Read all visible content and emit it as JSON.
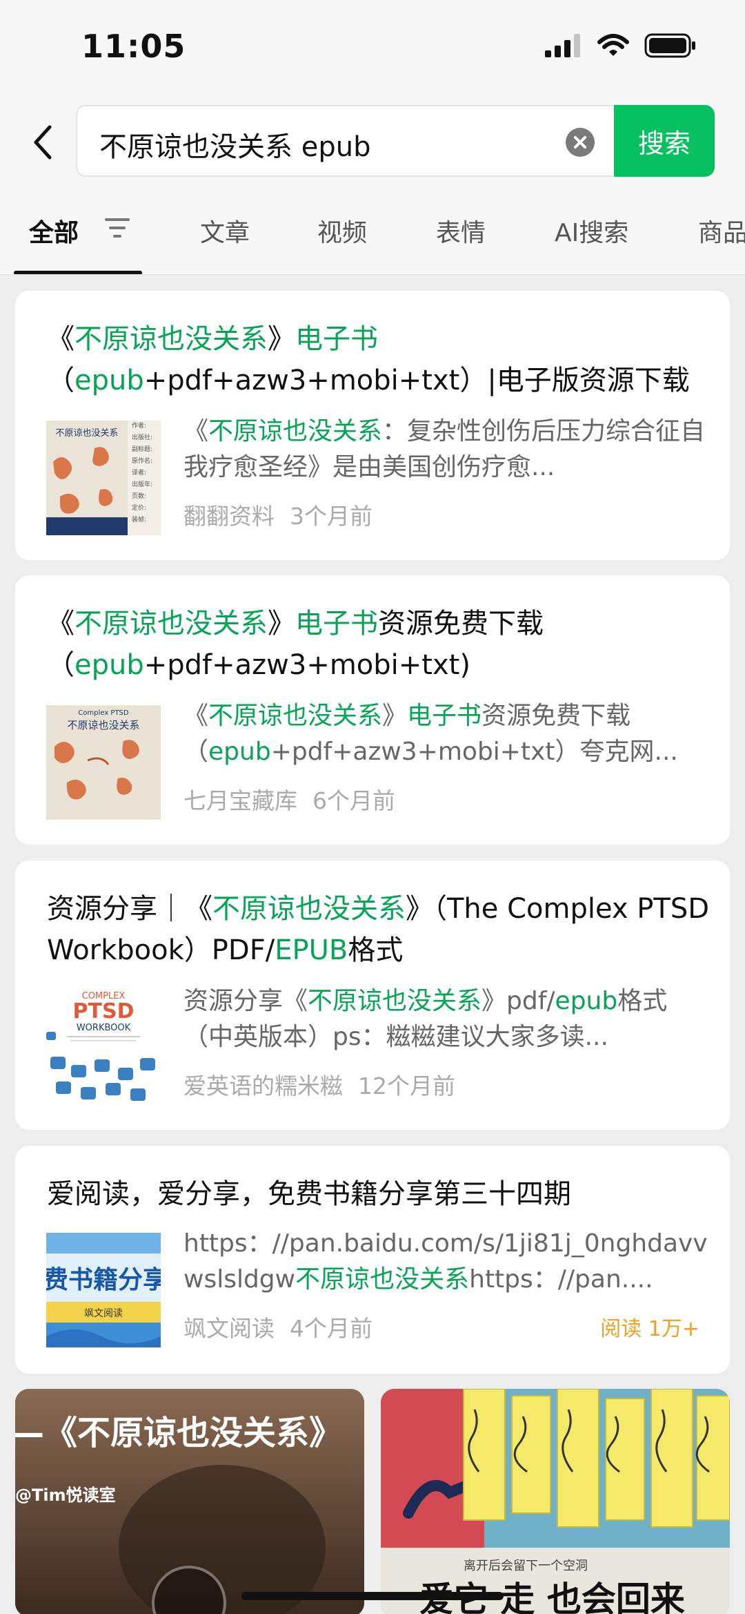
{
  "status_bar": {
    "time": "11:05"
  },
  "search": {
    "query": "不原谅也没关系 epub",
    "button_label": "搜索"
  },
  "tabs": [
    {
      "label": "全部",
      "active": true
    },
    {
      "label": "文章"
    },
    {
      "label": "视频"
    },
    {
      "label": "表情"
    },
    {
      "label": "AI搜索"
    },
    {
      "label": "商品"
    }
  ],
  "results": [
    {
      "title_parts": [
        "《",
        "不原谅也没关系",
        "》",
        "电子书",
        "（",
        "epub",
        "+pdf+azw3+mobi+txt）|电子版资源下载"
      ],
      "snippet_parts": [
        "《",
        "不原谅也没关系",
        "：复杂性创伤后压力综合征自我疗愈圣经》是由美国创伤疗愈..."
      ],
      "source": "翻翻资料",
      "time": "3个月前"
    },
    {
      "title_parts": [
        "《",
        "不原谅也没关系",
        "》",
        "电子书",
        "资源免费下载（",
        "epub",
        "+pdf+azw3+mobi+txt)"
      ],
      "snippet_parts": [
        "《",
        "不原谅也没关系",
        "》",
        "电子书",
        "资源免费下载（",
        "epub",
        "+pdf+azw3+mobi+txt）夸克网..."
      ],
      "source": "七月宝藏库",
      "time": "6个月前"
    },
    {
      "title_parts": [
        "资源分享｜《",
        "不原谅也没关系",
        "》（The Complex PTSD Workbook）PDF/",
        "EPUB",
        "格式"
      ],
      "snippet_parts": [
        "资源分享《",
        "不原谅也没关系",
        "》pdf/",
        "epub",
        "格式（中英版本）ps：糍糍建议大家多读..."
      ],
      "source": "爱英语的糯米糍",
      "time": "12个月前"
    },
    {
      "title_parts": [
        "爱阅读，爱分享，免费书籍分享第三十四期"
      ],
      "snippet_parts": [
        "https：//pan.baidu.com/s/1ji81j_0nghdavvwslsldgw",
        "不原谅也没关系",
        "https：//pan...."
      ],
      "source": "飒文阅读",
      "time": "4个月前",
      "reads": "阅读 1万+"
    }
  ],
  "covers": {
    "book1_title": "不原谅也没关系",
    "book1_fields": [
      "作者:",
      "出版社:",
      "副标题:",
      "原作名:",
      "译者:",
      "出版年:",
      "页数:",
      "定价:",
      "装帧:"
    ],
    "book2_title": "不原谅也没关系",
    "book2_top": "Complex PTSD",
    "book3_lines": [
      "COMPLEX",
      "PTSD",
      "WORKBOOK"
    ],
    "book4_text": "费书籍分享",
    "book4_sub": "飒文阅读"
  },
  "videos": [
    {
      "caption": "—《不原谅也没关系》",
      "author": "@Tim悦读室"
    },
    {
      "caption": "爱它 走 也会回来",
      "note": "离开后会留下一个空洞"
    }
  ],
  "colors": {
    "accent": "#07c160",
    "highlight": "#07a455",
    "reads": "#f0a020"
  }
}
